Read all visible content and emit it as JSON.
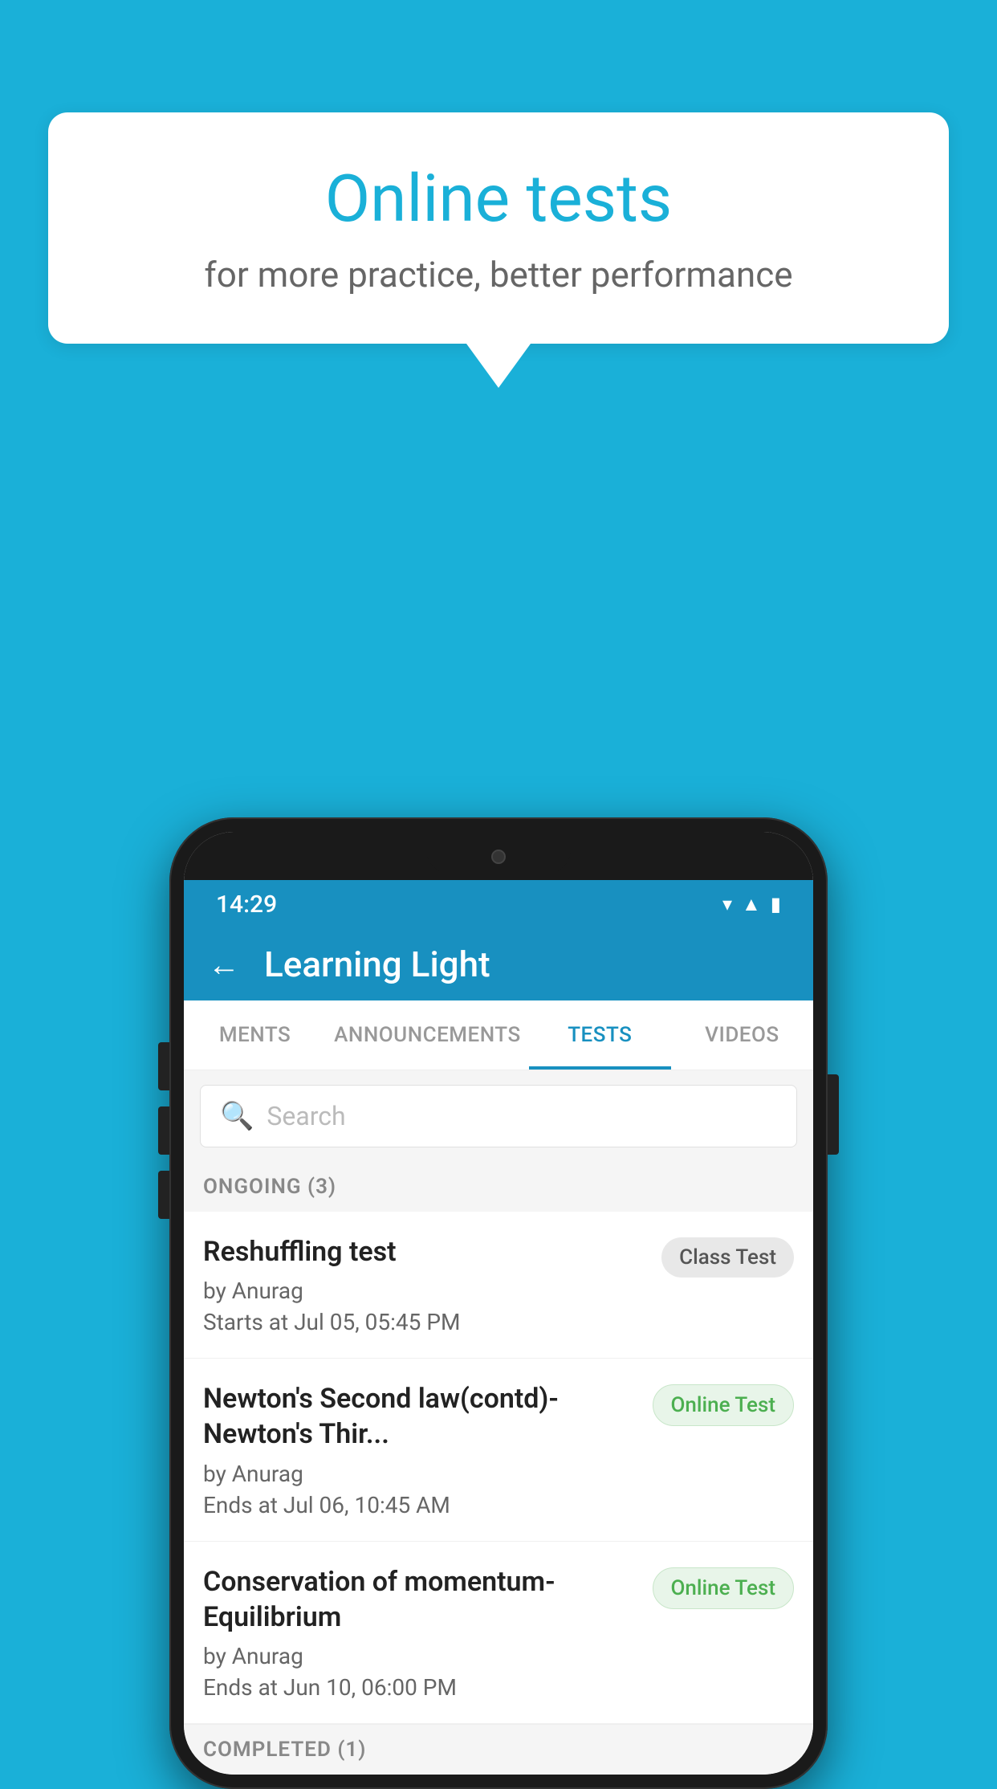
{
  "background_color": "#1ab0d8",
  "speech_bubble": {
    "title": "Online tests",
    "subtitle": "for more practice, better performance"
  },
  "phone": {
    "status_bar": {
      "time": "14:29",
      "icons": [
        "wifi",
        "signal",
        "battery"
      ]
    },
    "header": {
      "title": "Learning Light",
      "back_label": "←"
    },
    "tabs": [
      {
        "label": "MENTS",
        "active": false
      },
      {
        "label": "ANNOUNCEMENTS",
        "active": false
      },
      {
        "label": "TESTS",
        "active": true
      },
      {
        "label": "VIDEOS",
        "active": false
      }
    ],
    "search": {
      "placeholder": "Search"
    },
    "sections": [
      {
        "label": "ONGOING (3)",
        "items": [
          {
            "name": "Reshuffling test",
            "author": "by Anurag",
            "time": "Starts at  Jul 05, 05:45 PM",
            "badge": "Class Test",
            "badge_type": "class"
          },
          {
            "name": "Newton's Second law(contd)-Newton's Thir...",
            "author": "by Anurag",
            "time": "Ends at  Jul 06, 10:45 AM",
            "badge": "Online Test",
            "badge_type": "online"
          },
          {
            "name": "Conservation of momentum-Equilibrium",
            "author": "by Anurag",
            "time": "Ends at  Jun 10, 06:00 PM",
            "badge": "Online Test",
            "badge_type": "online"
          }
        ]
      },
      {
        "label": "COMPLETED (1)",
        "items": []
      }
    ]
  }
}
